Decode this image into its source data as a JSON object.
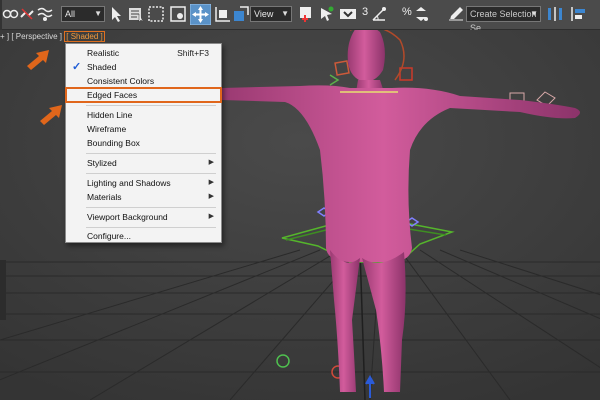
{
  "toolbar": {
    "selection_filter": "All",
    "coord_system": "View",
    "snap_angle": "3",
    "snap_percent": "%",
    "named_selection_placeholder": "Create Selection Se"
  },
  "viewport": {
    "label_prefix": "+ ] [ Perspective ] ",
    "label_shading": "[ Shaded ]"
  },
  "menu": {
    "items": [
      {
        "label": "Realistic",
        "shortcut": "Shift+F3"
      },
      {
        "label": "Shaded",
        "checked": true
      },
      {
        "label": "Consistent Colors"
      },
      {
        "label": "Edged Faces",
        "highlighted": true
      },
      {
        "label": "Hidden Line"
      },
      {
        "label": "Wireframe"
      },
      {
        "label": "Bounding Box"
      },
      {
        "label": "Stylized",
        "submenu": true
      },
      {
        "label": "Lighting and Shadows",
        "submenu": true
      },
      {
        "label": "Materials",
        "submenu": true
      },
      {
        "label": "Viewport Background",
        "submenu": true
      },
      {
        "label": "Configure..."
      }
    ],
    "check_mark": "✓",
    "submenu_arrow": "▶"
  },
  "colors": {
    "annotation": "#e0661b",
    "figure": "#c8508f",
    "rig": "#4ca82b"
  },
  "icons": [
    "link-icon",
    "unlink-icon",
    "bind-space-warp-icon",
    "select-object-icon",
    "select-by-name-icon",
    "rect-select-region-icon",
    "window-crossing-icon",
    "select-move-icon",
    "select-scale-icon",
    "use-pivot-center-icon",
    "select-manipulate-icon",
    "keyboard-shortcut-icon",
    "snaps-toggle-icon",
    "angle-snap-icon",
    "percent-snap-icon",
    "spinner-snap-icon",
    "edit-named-selections-icon",
    "mirror-icon",
    "align-icon"
  ]
}
